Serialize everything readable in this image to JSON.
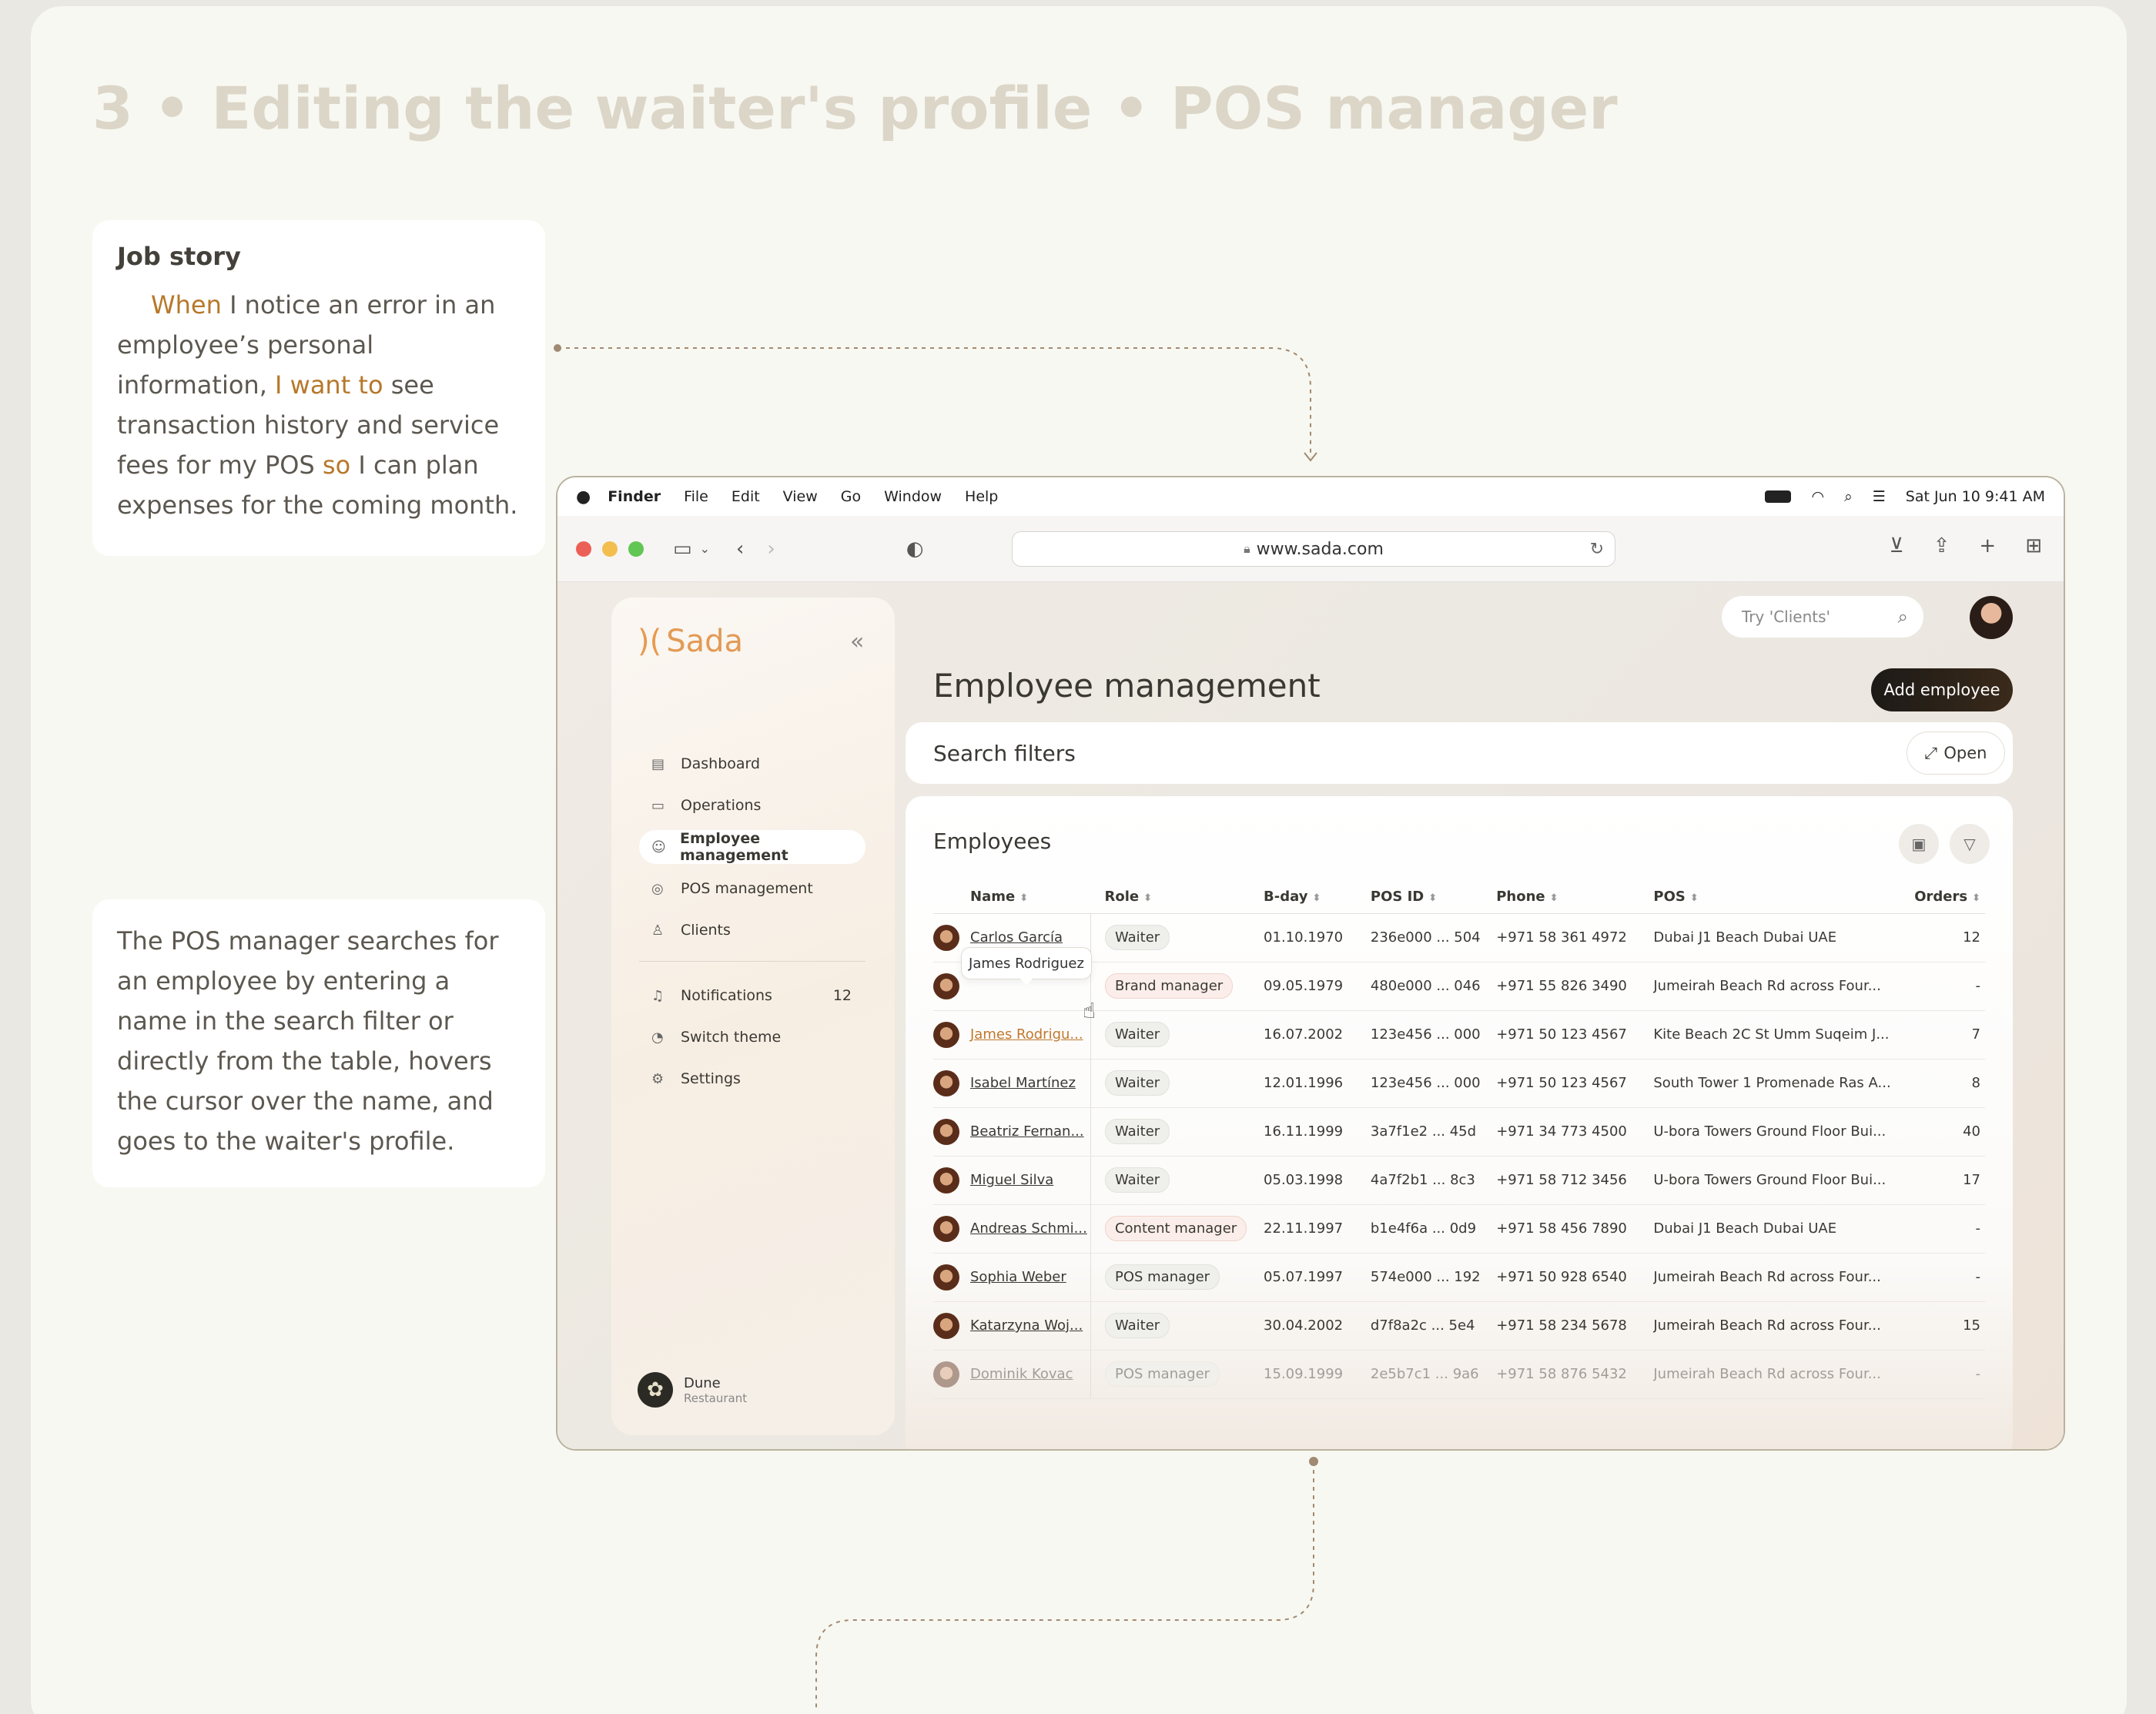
{
  "slide": {
    "title": "3 • Editing the waiter's profile • POS manager"
  },
  "job_story": {
    "title": "Job story",
    "when": "When",
    "part1": " I notice an error in an employee’s personal information, ",
    "want": "I want to",
    "part2": " see transaction history and service fees for my POS ",
    "so": "so",
    "part3": " I can plan expenses for the coming month."
  },
  "scenario": {
    "text": "The POS manager searches for an employee by entering a name in the search filter or directly from the table, hovers the cursor over the name, and goes to the waiter's profile."
  },
  "menubar": {
    "app": "Finder",
    "items": [
      "File",
      "Edit",
      "View",
      "Go",
      "Window",
      "Help"
    ],
    "datetime": "Sat Jun 10  9:41 AM"
  },
  "browser": {
    "url": "www.sada.com"
  },
  "sidebar": {
    "brand": "Sada",
    "items": [
      {
        "label": "Dashboard",
        "icon": "dashboard-icon"
      },
      {
        "label": "Operations",
        "icon": "operations-icon"
      },
      {
        "label": "Employee management",
        "icon": "employees-icon"
      },
      {
        "label": "POS management",
        "icon": "pos-icon"
      },
      {
        "label": "Clients",
        "icon": "clients-icon"
      }
    ],
    "secondary": [
      {
        "label": "Notifications",
        "icon": "bell-icon",
        "count": "12"
      },
      {
        "label": "Switch theme",
        "icon": "theme-icon"
      },
      {
        "label": "Settings",
        "icon": "gear-icon"
      }
    ],
    "org": {
      "name": "Dune",
      "type": "Restaurant"
    }
  },
  "header": {
    "search_placeholder": "Try 'Clients'",
    "page_title": "Employee management",
    "add_button": "Add employee"
  },
  "filters": {
    "title": "Search filters",
    "open_label": "Open"
  },
  "employees": {
    "title": "Employees",
    "tooltip": "James Rodriguez",
    "columns": [
      "Name",
      "Role",
      "B-day",
      "POS ID",
      "Phone",
      "POS",
      "Orders"
    ],
    "rows": [
      {
        "name": "Carlos García",
        "role": "Waiter",
        "bday": "01.10.1970",
        "pos_id": "236e000 ... 504",
        "phone": "+971 58 361 4972",
        "pos": "Dubai J1 Beach Dubai UAE",
        "orders": "12"
      },
      {
        "name": "",
        "role": "Brand manager",
        "bday": "09.05.1979",
        "pos_id": "480e000 ... 046",
        "phone": "+971 55 826 3490",
        "pos": "Jumeirah Beach Rd across Four...",
        "orders": "-"
      },
      {
        "name": "James Rodrigu...",
        "role": "Waiter",
        "bday": "16.07.2002",
        "pos_id": "123e456 ... 000",
        "phone": "+971 50 123 4567",
        "pos": "Kite Beach 2C St Umm Suqeim J...",
        "orders": "7"
      },
      {
        "name": "Isabel Martínez",
        "role": "Waiter",
        "bday": "12.01.1996",
        "pos_id": "123e456 ... 000",
        "phone": "+971 50 123 4567",
        "pos": "South Tower 1 Promenade Ras A...",
        "orders": "8"
      },
      {
        "name": "Beatriz Fernan...",
        "role": "Waiter",
        "bday": "16.11.1999",
        "pos_id": "3a7f1e2 ... 45d",
        "phone": "+971 34 773 4500",
        "pos": "U-bora Towers Ground Floor Bui...",
        "orders": "40"
      },
      {
        "name": "Miguel Silva",
        "role": "Waiter",
        "bday": "05.03.1998",
        "pos_id": "4a7f2b1 ... 8c3",
        "phone": "+971 58 712 3456",
        "pos": "U-bora Towers Ground Floor Bui...",
        "orders": "17"
      },
      {
        "name": "Andreas Schmi...",
        "role": "Content manager",
        "bday": "22.11.1997",
        "pos_id": "b1e4f6a ... 0d9",
        "phone": "+971 58 456 7890",
        "pos": "Dubai J1 Beach Dubai UAE",
        "orders": "-"
      },
      {
        "name": "Sophia Weber",
        "role": "POS manager",
        "bday": "05.07.1997",
        "pos_id": "574e000 ... 192",
        "phone": "+971 50 928 6540",
        "pos": "Jumeirah Beach Rd across Four...",
        "orders": "-"
      },
      {
        "name": "Katarzyna Woj...",
        "role": "Waiter",
        "bday": "30.04.2002",
        "pos_id": "d7f8a2c ... 5e4",
        "phone": "+971 58 234 5678",
        "pos": "Jumeirah Beach Rd across Four...",
        "orders": "15"
      },
      {
        "name": "Dominik Kovac",
        "role": "POS manager",
        "bday": "15.09.1999",
        "pos_id": "2e5b7c1 ... 9a6",
        "phone": "+971 58 876 5432",
        "pos": "Jumeirah Beach Rd across Four...",
        "orders": "-"
      }
    ]
  },
  "colors": {
    "accent": "#b7782a",
    "brand": "#e29a55",
    "background": "#f8f8f2"
  }
}
